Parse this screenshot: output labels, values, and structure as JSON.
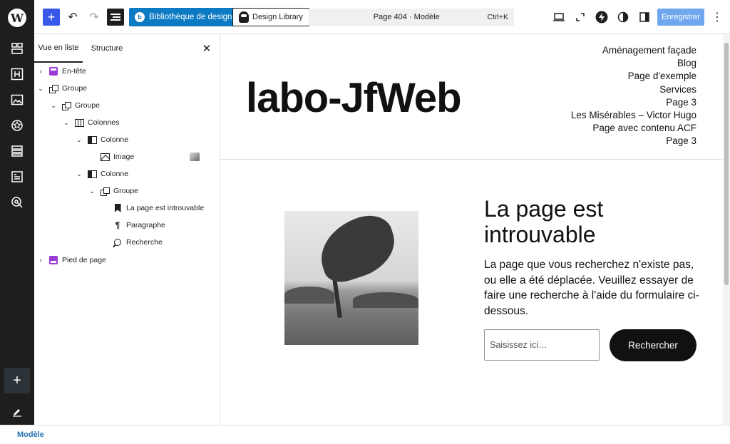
{
  "toolbar": {
    "library_button": "Bibliothèque de design",
    "design_library_button": "Design Library",
    "command": {
      "title": "Page 404 · Modèle",
      "shortcut": "Ctrl+K"
    },
    "save_label": "Enregistrer"
  },
  "listview": {
    "tabs": [
      "Vue en liste",
      "Structure"
    ],
    "items": [
      {
        "label": "En-tête",
        "icon": "template-part-header-icon"
      },
      {
        "label": "Groupe",
        "icon": "group-icon"
      },
      {
        "label": "Groupe",
        "icon": "group-icon"
      },
      {
        "label": "Colonnes",
        "icon": "columns-icon"
      },
      {
        "label": "Colonne",
        "icon": "column-icon"
      },
      {
        "label": "Image",
        "icon": "image-icon"
      },
      {
        "label": "Colonne",
        "icon": "column-icon"
      },
      {
        "label": "Groupe",
        "icon": "group-icon"
      },
      {
        "label": "La page est introuvable",
        "icon": "bookmark-icon"
      },
      {
        "label": "Paragraphe",
        "icon": "paragraph-icon"
      },
      {
        "label": "Recherche",
        "icon": "search-icon"
      },
      {
        "label": "Pied de page",
        "icon": "template-part-footer-icon"
      }
    ]
  },
  "canvas": {
    "site_title": "labo-JfWeb",
    "nav": [
      "Aménagement façade",
      "Blog",
      "Page d'exemple",
      "Services",
      "Page 3",
      "Les Misérables – Victor Hugo",
      "Page avec contenu ACF",
      "Page 3"
    ],
    "heading": "La page est introuvable",
    "lead": "La page que vous recherchez n'existe pas, ou elle a été déplacée. Veuillez essayer de faire une recherche à l'aide du formulaire ci-dessous.",
    "search_placeholder": "Saisissez ici…",
    "search_button": "Rechercher"
  },
  "footer": {
    "breadcrumb": "Modèle"
  },
  "colors": {
    "accent": "#3858e9",
    "library_blue": "#0d7bc4",
    "save_disabled": "#6fa6ee",
    "header_part": "#9b3bd8"
  }
}
